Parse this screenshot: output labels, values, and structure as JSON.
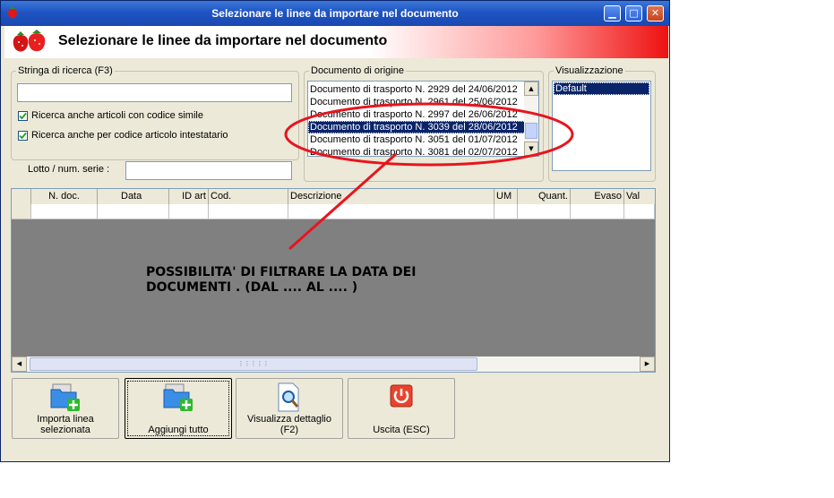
{
  "window": {
    "title": "Selezionare le linee da importare nel documento",
    "buttons": {
      "minimize": "▁",
      "maximize": "□",
      "close": "✕"
    }
  },
  "header": {
    "text": "Selezionare le linee da importare nel documento"
  },
  "search": {
    "legend": "Stringa di ricerca (F3)",
    "value": "",
    "checkbox1": {
      "label": "Ricerca anche articoli con codice simile",
      "checked": true
    },
    "checkbox2": {
      "label": "Ricerca anche per codice articolo intestatario",
      "checked": true
    },
    "lotto_label": "Lotto / num. serie :",
    "lotto_value": ""
  },
  "origin": {
    "legend": "Documento di origine",
    "items": [
      "Documento di trasporto N. 2929 del 24/06/2012",
      "Documento di trasporto N. 2961 del 25/06/2012",
      "Documento di trasporto N. 2997 del 26/06/2012",
      "Documento di trasporto N. 3039 del 28/06/2012",
      "Documento di trasporto N. 3051 del 01/07/2012",
      "Documento di trasporto N. 3081 del 02/07/2012"
    ],
    "selected_index": 3
  },
  "view": {
    "legend": "Visualizzazione",
    "items": [
      "Default"
    ]
  },
  "table": {
    "columns": [
      "",
      "N. doc.",
      "Data",
      "ID art",
      "Cod.",
      "Descrizione",
      "UM",
      "Quant.",
      "Evaso",
      "Val"
    ]
  },
  "annotation": {
    "line1": "POSSIBILITA' DI FILTRARE LA DATA DEI",
    "line2": "DOCUMENTI . (DAL .... AL .... )",
    "color": "#e8141e"
  },
  "actions": {
    "import_line": "Importa linea selezionata",
    "add_all": "Aggiungi tutto",
    "view_detail": "Visualizza dettaglio (F2)",
    "exit": "Uscita (ESC)"
  }
}
